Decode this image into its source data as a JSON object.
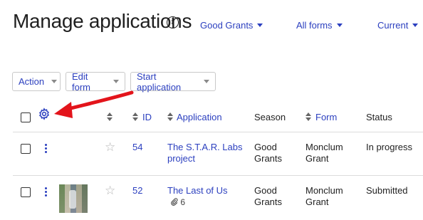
{
  "page": {
    "title": "Manage applications"
  },
  "filters": [
    {
      "label": "Good Grants"
    },
    {
      "label": "All forms"
    },
    {
      "label": "Current"
    }
  ],
  "toolbar": {
    "action_label": "Action",
    "edit_form_label": "Edit form",
    "start_application_label": "Start application"
  },
  "table": {
    "headers": {
      "id": "ID",
      "application": "Application",
      "season": "Season",
      "form": "Form",
      "status": "Status"
    },
    "rows": [
      {
        "id": "54",
        "application_line1": "The S.T.A.R. Labs",
        "application_line2": "project",
        "season_line1": "Good",
        "season_line2": "Grants",
        "form_line1": "Monclum",
        "form_line2": "Grant",
        "status": "In progress"
      },
      {
        "id": "52",
        "application_line1": "The Last of Us",
        "attachments": "6",
        "season_line1": "Good",
        "season_line2": "Grants",
        "form_line1": "Monclum",
        "form_line2": "Grant",
        "status": "Submitted"
      }
    ]
  },
  "icons": {
    "info": "info-icon",
    "gear": "gear-icon",
    "sort": "sort-icon",
    "kebab": "more-vertical-icon",
    "star": "star-icon",
    "paperclip": "paperclip-icon",
    "annotation_arrow": "red-arrow-icon"
  },
  "colors": {
    "link": "#2b3fbf",
    "annotation": "#e3141b",
    "rule": "#dcdcdc"
  }
}
